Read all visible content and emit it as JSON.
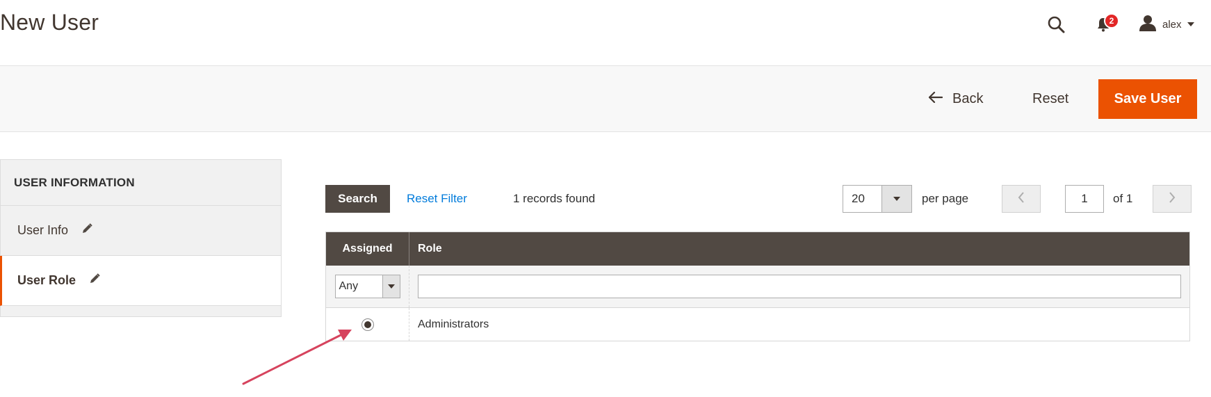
{
  "header": {
    "title": "New User",
    "notifications_count": "2",
    "username": "alex",
    "icons": {
      "search": "search-icon",
      "notifications": "bell-icon",
      "user": "user-icon"
    }
  },
  "actions": {
    "back_label": "Back",
    "reset_label": "Reset",
    "save_label": "Save User"
  },
  "sidebar": {
    "title": "USER INFORMATION",
    "items": [
      {
        "label": "User Info",
        "active": false
      },
      {
        "label": "User Role",
        "active": true
      }
    ]
  },
  "grid": {
    "search_label": "Search",
    "reset_filter_label": "Reset Filter",
    "records_found": "1 records found",
    "per_page_value": "20",
    "per_page_label": "per page",
    "current_page": "1",
    "page_of": "of 1",
    "columns": {
      "assigned": "Assigned",
      "role": "Role"
    },
    "filter": {
      "assigned_value": "Any",
      "role_value": ""
    },
    "rows": [
      {
        "assigned": true,
        "role": "Administrators"
      }
    ]
  },
  "colors": {
    "accent": "#eb5202",
    "grid_header": "#514943",
    "link": "#007bdb",
    "badge": "#e22626",
    "annotation_arrow": "#d6435d"
  }
}
